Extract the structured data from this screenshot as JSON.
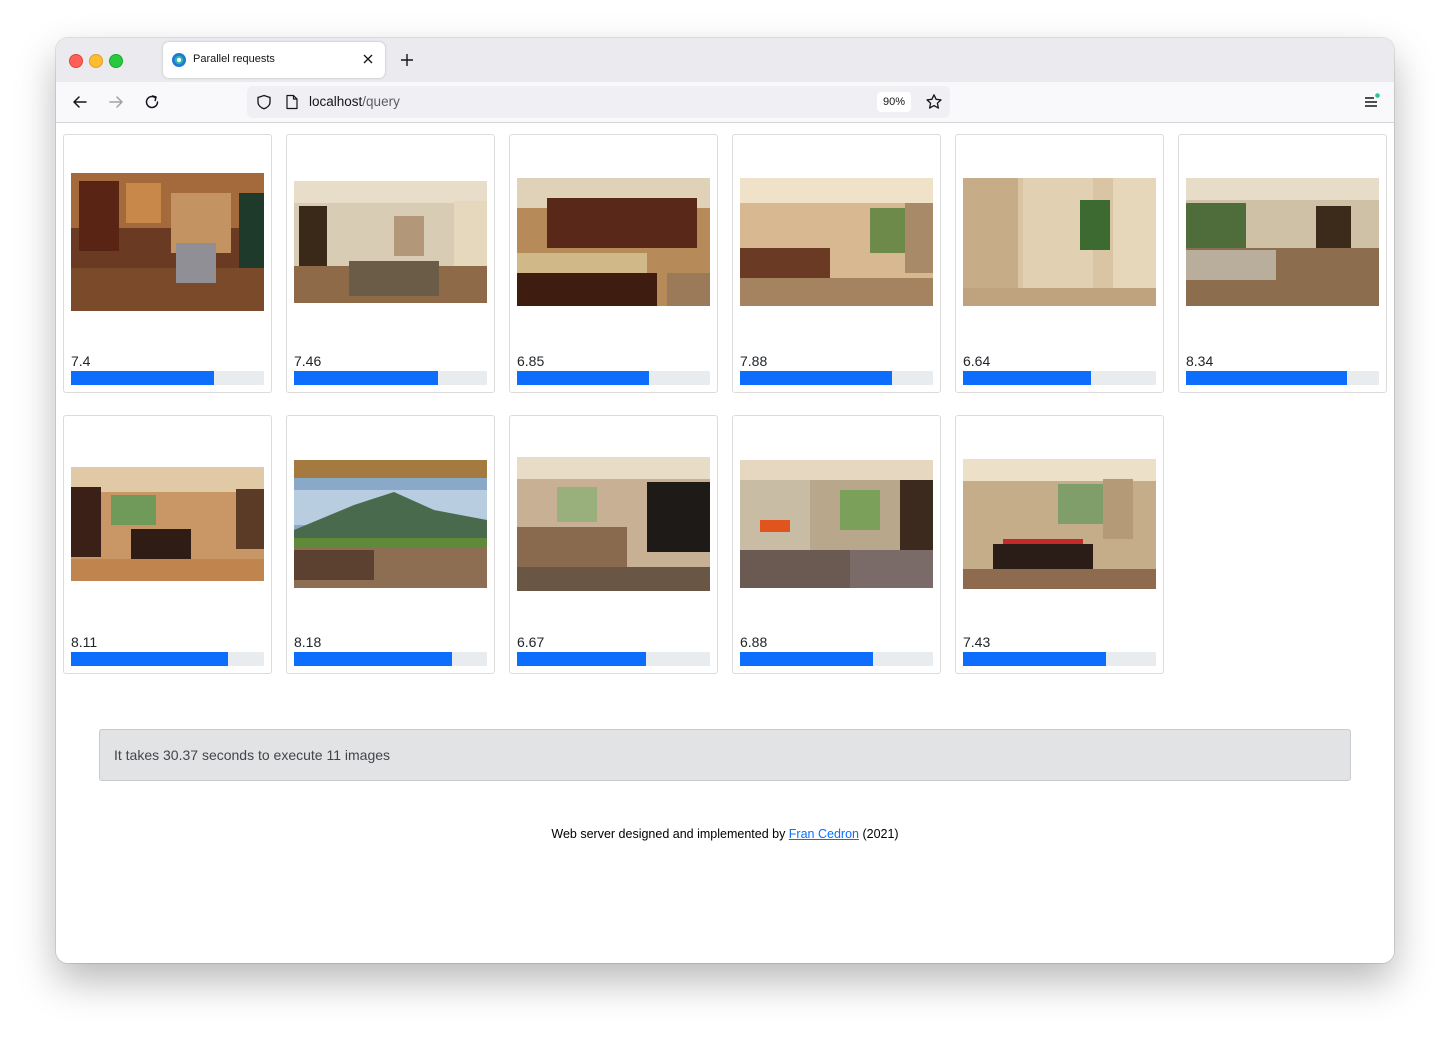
{
  "browser": {
    "tab_title": "Parallel requests",
    "url_host": "localhost",
    "url_path": "/query",
    "zoom": "90%"
  },
  "cards": [
    {
      "score": "7.4",
      "value": 0.74,
      "photo": "kitchen"
    },
    {
      "score": "7.46",
      "value": 0.746,
      "photo": "living-room"
    },
    {
      "score": "6.85",
      "value": 0.685,
      "photo": "kitchen-island"
    },
    {
      "score": "7.88",
      "value": 0.788,
      "photo": "bedroom"
    },
    {
      "score": "6.64",
      "value": 0.664,
      "photo": "bathroom"
    },
    {
      "score": "8.34",
      "value": 0.834,
      "photo": "living-room"
    },
    {
      "score": "8.11",
      "value": 0.811,
      "photo": "kitchen-open"
    },
    {
      "score": "8.18",
      "value": 0.818,
      "photo": "living-room-view"
    },
    {
      "score": "6.67",
      "value": 0.667,
      "photo": "bedroom"
    },
    {
      "score": "6.88",
      "value": 0.688,
      "photo": "living-room-fireplace"
    },
    {
      "score": "7.43",
      "value": 0.743,
      "photo": "dining-room"
    }
  ],
  "summary": {
    "text": "It takes 30.37 seconds to execute 11 images"
  },
  "footer": {
    "prefix": "Web server designed and implemented by ",
    "author_link": "Fran Cedron",
    "suffix": " (2021)"
  },
  "colors": {
    "progress": "#0d6efd",
    "track": "#e9ecef"
  }
}
